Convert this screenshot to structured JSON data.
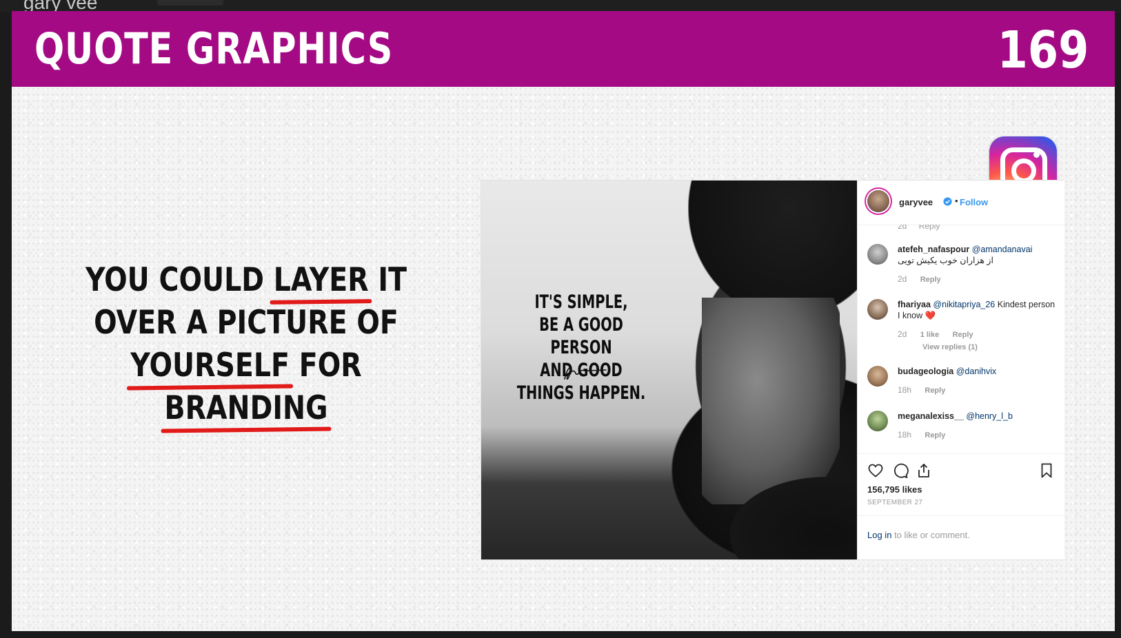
{
  "window": {
    "title": "gary vee"
  },
  "slide": {
    "title": "QUOTE GRAPHICS",
    "page_number": "169",
    "headline": {
      "line1": {
        "w1": "YOU COULD",
        "w2": "LAYER",
        "w3": "IT"
      },
      "line2": "OVER A PICTURE OF",
      "line3": {
        "w1": "YOURSELF",
        "w2": "FOR",
        "w3": "BRANDING"
      }
    }
  },
  "post": {
    "quote_lines": [
      "IT'S SIMPLE,",
      "BE A GOOD PERSON",
      "AND GOOD THINGS HAPPEN."
    ],
    "username": "garyvee",
    "separator": "•",
    "follow_label": "Follow",
    "partial_comment": {
      "time": "2d",
      "reply": "Reply"
    },
    "comments": [
      {
        "user": "atefeh_nafaspour",
        "mention": "@amandanavai",
        "text": "از هزاران خوب یکیش تویی",
        "time": "2d",
        "likes": "",
        "reply": "Reply",
        "replies": ""
      },
      {
        "user": "fhariyaa",
        "mention": "@nikitapriya_26",
        "text": "Kindest person I know",
        "heart": "❤️",
        "time": "2d",
        "likes": "1 like",
        "reply": "Reply",
        "replies": "View replies (1)"
      },
      {
        "user": "budageologia",
        "mention": "@danihvix",
        "text": "",
        "time": "18h",
        "likes": "",
        "reply": "Reply",
        "replies": ""
      },
      {
        "user": "meganalexiss__",
        "mention": "@henry_l_b",
        "text": "",
        "time": "18h",
        "likes": "",
        "reply": "Reply",
        "replies": ""
      }
    ],
    "likes": "156,795 likes",
    "date": "SEPTEMBER 27",
    "login_link": "Log in",
    "login_rest": " to like or comment."
  },
  "colors": {
    "header_bg": "#a30a83",
    "underline": "#e11a1a",
    "follow": "#3897f0",
    "mention": "#003569"
  },
  "icons": [
    "instagram-logo-icon",
    "heart-icon",
    "comment-icon",
    "share-icon",
    "bookmark-icon",
    "verified-badge-icon",
    "signature-icon"
  ]
}
